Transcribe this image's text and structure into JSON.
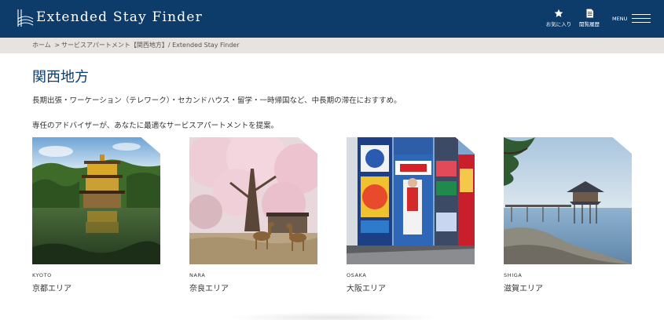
{
  "header": {
    "site_title": "Extended Stay Finder",
    "favorites_label": "お気に入り",
    "history_label": "閲覧履歴",
    "menu_label": "MENU",
    "background_color": "#0d3b6a"
  },
  "breadcrumb": {
    "home": "ホーム",
    "separator": ">",
    "middle": "サービスアパートメント【関西地方】/ Extended Stay Finder"
  },
  "main": {
    "title": "関西地方",
    "intro_line1": "長期出張・ワーケーション（テレワーク）・セカンドハウス・留学・一時帰国など、中長期の滞在におすすめ。",
    "intro_line2": "専任のアドバイザーが、あなたに最適なサービスアパートメントを提案。"
  },
  "areas": [
    {
      "code": "KYOTO",
      "name": "京都エリア",
      "image": "golden-pavilion-photo"
    },
    {
      "code": "NARA",
      "name": "奈良エリア",
      "image": "cherry-blossom-deer-photo"
    },
    {
      "code": "OSAKA",
      "name": "大阪エリア",
      "image": "dotonbori-signs-photo"
    },
    {
      "code": "SHIGA",
      "name": "滋賀エリア",
      "image": "lake-pavilion-photo"
    }
  ]
}
